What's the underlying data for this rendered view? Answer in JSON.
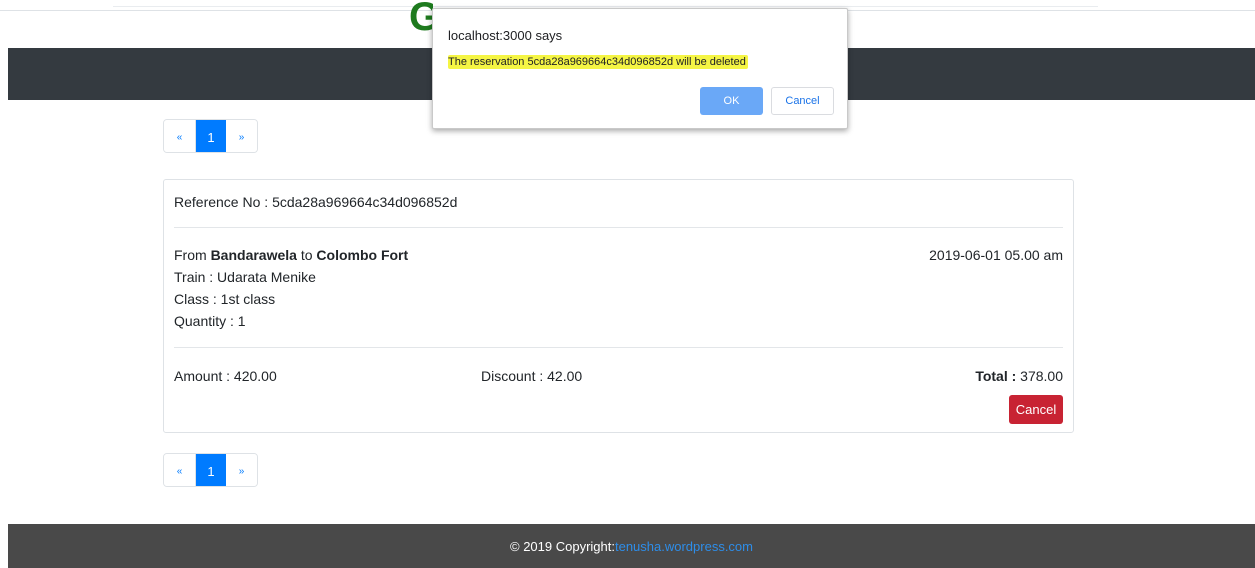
{
  "header": {
    "logo_letter": "G"
  },
  "pagination": {
    "prev_label": "«",
    "current_page": "1",
    "next_label": "»"
  },
  "reservation": {
    "reference_label": "Reference No : ",
    "reference_no": "5cda28a969664c34d096852d",
    "from_label": "From ",
    "from_station": "Bandarawela",
    "to_label": " to ",
    "to_station": "Colombo Fort",
    "date_time": "2019-06-01 05.00 am",
    "train_text": "Train : Udarata Menike",
    "class_text": "Class : 1st class",
    "quantity_text": "Quantity : 1",
    "amount_text": "Amount : 420.00",
    "discount_text": "Discount : 42.00",
    "total_label": "Total : ",
    "total_value": "378.00",
    "cancel_label": "Cancel"
  },
  "footer": {
    "copyright_text": "© 2019 Copyright: ",
    "link_text": "tenusha.wordpress.com"
  },
  "dialog": {
    "title": "localhost:3000 says",
    "message": "The reservation 5cda28a969664c34d096852d will be deleted",
    "ok_label": "OK",
    "cancel_label": "Cancel"
  },
  "colors": {
    "navbar": "#343a40",
    "primary": "#007bff",
    "danger": "#c82333",
    "footer": "#494949",
    "highlight": "#f5f544"
  }
}
